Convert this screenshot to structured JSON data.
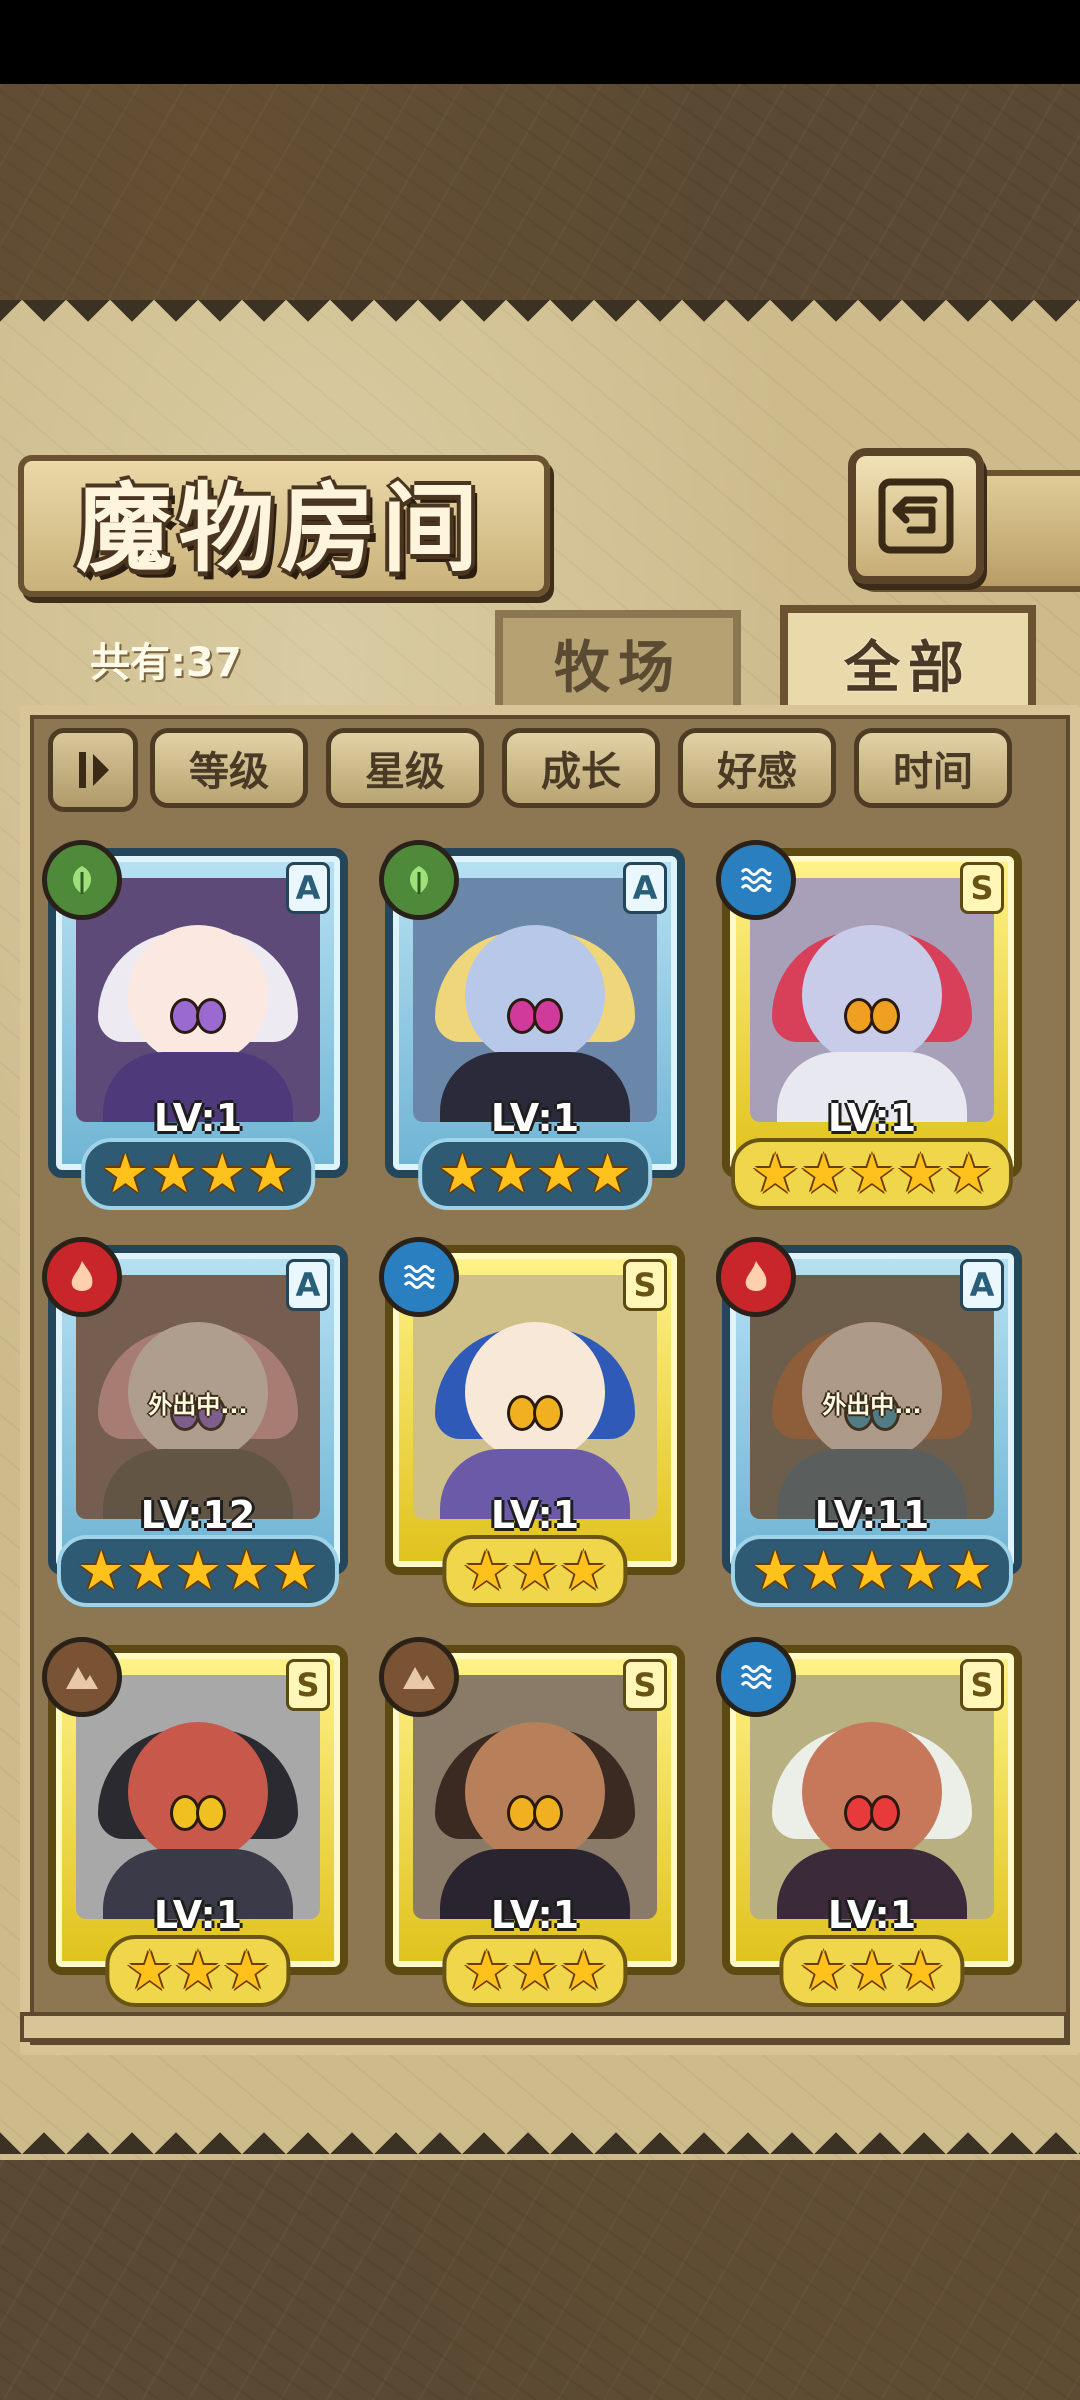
{
  "title": "魔物房间",
  "count_label": "共有:37",
  "tabs": [
    {
      "label": "牧场",
      "active": false
    },
    {
      "label": "全部",
      "active": true
    }
  ],
  "sort_buttons": [
    "等级",
    "星级",
    "成长",
    "好感",
    "时间"
  ],
  "icons": {
    "back": "back-arrow-icon",
    "sort_toggle": "sort-order-icon",
    "elements": {
      "wood": "leaf-icon",
      "water": "water-wave-icon",
      "fire": "flame-icon",
      "earth": "mountain-icon"
    }
  },
  "colors": {
    "rank_A_frame": "#6fb4d4",
    "rank_S_frame": "#e0c21c",
    "star": "#ffc21c",
    "wood": "#4f8a3a",
    "water": "#2a7fc0",
    "fire": "#c8262a",
    "earth": "#7a5234"
  },
  "monsters": [
    {
      "element": "wood",
      "rank": "A",
      "level": "LV:1",
      "stars": "★★★★",
      "star_count": 4
    },
    {
      "element": "wood",
      "rank": "A",
      "level": "LV:1",
      "stars": "★★★★",
      "star_count": 4
    },
    {
      "element": "water",
      "rank": "S",
      "level": "LV:1",
      "stars": "★★★★★",
      "star_count": 5
    },
    {
      "element": "fire",
      "rank": "A",
      "level": "LV:12",
      "stars": "★★★★★",
      "star_count": 5,
      "status": "外出中..."
    },
    {
      "element": "water",
      "rank": "S",
      "level": "LV:1",
      "stars": "★★★",
      "star_count": 3
    },
    {
      "element": "fire",
      "rank": "A",
      "level": "LV:11",
      "stars": "★★★★★",
      "star_count": 5,
      "status": "外出中..."
    },
    {
      "element": "earth",
      "rank": "S",
      "level": "LV:1",
      "stars": "★★★",
      "star_count": 3
    },
    {
      "element": "earth",
      "rank": "S",
      "level": "LV:1",
      "stars": "★★★",
      "star_count": 3
    },
    {
      "element": "water",
      "rank": "S",
      "level": "LV:1",
      "stars": "★★★",
      "star_count": 3
    }
  ]
}
